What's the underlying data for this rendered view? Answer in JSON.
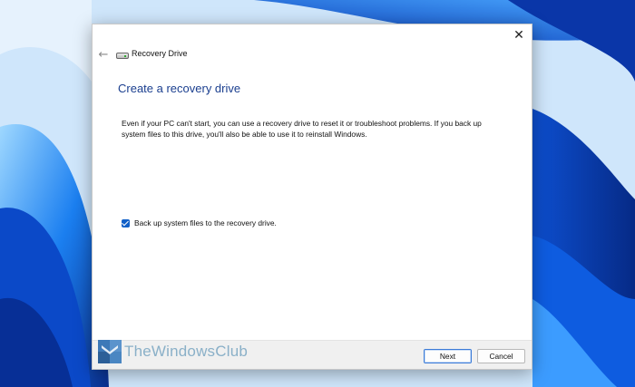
{
  "window": {
    "title": "Recovery Drive",
    "heading": "Create a recovery drive",
    "description": "Even if your PC can't start, you can use a recovery drive to reset it or troubleshoot problems. If you back up system files to this drive, you'll also be able to use it to reinstall Windows.",
    "checkbox": {
      "label": "Back up system files to the recovery drive.",
      "checked": true
    },
    "buttons": {
      "next": "Next",
      "cancel": "Cancel"
    },
    "close_glyph": "✕",
    "back_glyph": "←"
  },
  "watermark": {
    "text": "TheWindowsClub"
  },
  "colors": {
    "accent": "#1160c8",
    "heading": "#1b3f8f",
    "wallpaper": "#1a6cf0"
  },
  "icons": [
    "back-arrow-icon",
    "drive-icon",
    "close-icon",
    "thewindowsclub-logo-icon"
  ]
}
